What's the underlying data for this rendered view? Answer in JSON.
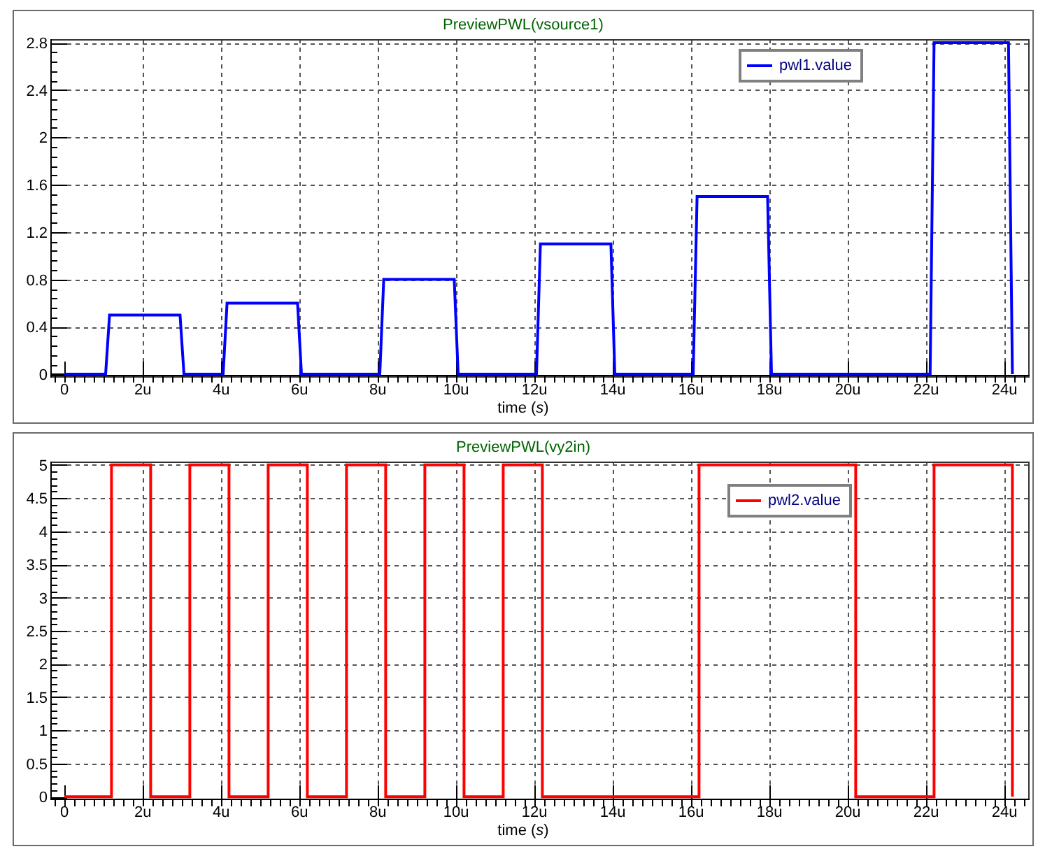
{
  "plots": [
    {
      "chart_data": {
        "type": "line",
        "title": "PreviewPWL(vsource1)",
        "xlabel": "time (*s*)",
        "x": [
          0,
          1.05,
          1.15,
          2.95,
          3.05,
          4.05,
          4.15,
          5.95,
          6.05,
          8.05,
          8.15,
          9.95,
          10.05,
          12.05,
          12.15,
          13.95,
          14.05,
          16.05,
          16.15,
          17.95,
          18.05,
          22.1,
          22.2,
          24.1,
          24.2
        ],
        "series": [
          {
            "name": "pwl1.value",
            "color": "#0000ff",
            "values": [
              0,
              0,
              0.5,
              0.5,
              0,
              0,
              0.6,
              0.6,
              0,
              0,
              0.8,
              0.8,
              0,
              0,
              1.1,
              1.1,
              0,
              0,
              1.5,
              1.5,
              0,
              0,
              2.8,
              2.8,
              0
            ]
          }
        ],
        "xlim": [
          -0.36,
          24.64
        ],
        "ylim": [
          -0.03,
          2.83
        ],
        "xticks": [
          {
            "value": 0,
            "label": "0"
          },
          {
            "value": 2,
            "label": "2u"
          },
          {
            "value": 4,
            "label": "4u"
          },
          {
            "value": 6,
            "label": "6u"
          },
          {
            "value": 8,
            "label": "8u"
          },
          {
            "value": 10,
            "label": "10u"
          },
          {
            "value": 12,
            "label": "12u"
          },
          {
            "value": 14,
            "label": "14u"
          },
          {
            "value": 16,
            "label": "16u"
          },
          {
            "value": 18,
            "label": "18u"
          },
          {
            "value": 20,
            "label": "20u"
          },
          {
            "value": 22,
            "label": "22u"
          },
          {
            "value": 24,
            "label": "24u"
          }
        ],
        "yticks": [
          0,
          0.4,
          0.8,
          1.2,
          1.6,
          2,
          2.4,
          2.8
        ],
        "grid": true
      }
    },
    {
      "chart_data": {
        "type": "line",
        "title": "PreviewPWL(vy2in)",
        "xlabel": "time (*s*)",
        "x": [
          0,
          1.2,
          1.2,
          2.2,
          2.2,
          3.2,
          3.2,
          4.2,
          4.2,
          5.2,
          5.2,
          6.2,
          6.2,
          7.2,
          7.2,
          8.2,
          8.2,
          9.2,
          9.2,
          10.2,
          10.2,
          11.2,
          11.2,
          12.2,
          12.2,
          16.2,
          16.2,
          20.2,
          20.2,
          22.2,
          22.2,
          24.2,
          24.2
        ],
        "series": [
          {
            "name": "pwl2.value",
            "color": "#ff0000",
            "values": [
              0,
              0,
              5,
              5,
              0,
              0,
              5,
              5,
              0,
              0,
              5,
              5,
              0,
              0,
              5,
              5,
              0,
              0,
              5,
              5,
              0,
              0,
              5,
              5,
              0,
              0,
              5,
              5,
              0,
              0,
              5,
              5,
              0
            ]
          }
        ],
        "xlim": [
          -0.36,
          24.64
        ],
        "ylim": [
          -0.05,
          5.05
        ],
        "xticks": [
          {
            "value": 0,
            "label": "0"
          },
          {
            "value": 2,
            "label": "2u"
          },
          {
            "value": 4,
            "label": "4u"
          },
          {
            "value": 6,
            "label": "6u"
          },
          {
            "value": 8,
            "label": "8u"
          },
          {
            "value": 10,
            "label": "10u"
          },
          {
            "value": 12,
            "label": "12u"
          },
          {
            "value": 14,
            "label": "14u"
          },
          {
            "value": 16,
            "label": "16u"
          },
          {
            "value": 18,
            "label": "18u"
          },
          {
            "value": 20,
            "label": "20u"
          },
          {
            "value": 22,
            "label": "22u"
          },
          {
            "value": 24,
            "label": "24u"
          }
        ],
        "yticks": [
          0,
          0.5,
          1,
          1.5,
          2,
          2.5,
          3,
          3.5,
          4,
          4.5,
          5
        ],
        "grid": true
      }
    }
  ]
}
